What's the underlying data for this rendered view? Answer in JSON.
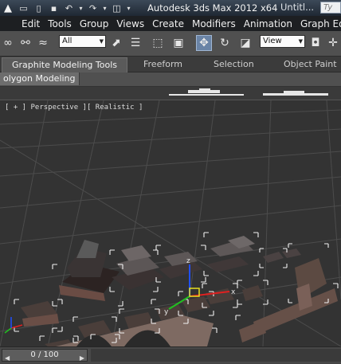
{
  "titlebar": {
    "app_icon": "3ds-max-logo",
    "title": "Autodesk 3ds Max  2012 x64",
    "document": "Untitl...",
    "search_placeholder": "Ty"
  },
  "menubar": {
    "items": [
      "Edit",
      "Tools",
      "Group",
      "Views",
      "Create",
      "Modifiers",
      "Animation",
      "Graph Edi"
    ]
  },
  "toolbar": {
    "selection_filter": "All",
    "reference_coord": "View"
  },
  "ribbon": {
    "tabs": [
      "Graphite Modeling Tools",
      "Freeform",
      "Selection",
      "Object Paint"
    ],
    "active_tab": "Graphite Modeling Tools"
  },
  "panel": {
    "label": "olygon Modeling"
  },
  "viewport": {
    "label": "[ + ] Perspective ][ Realistic ]",
    "axis_labels": [
      "x",
      "y",
      "z"
    ]
  },
  "timeline": {
    "frame_label": "0 / 100"
  },
  "colors": {
    "titlebar": "#2a3542",
    "menubar": "#1d1f22",
    "toolbar": "#505050",
    "viewport": "#333333",
    "active_tool": "#6a84a6"
  }
}
